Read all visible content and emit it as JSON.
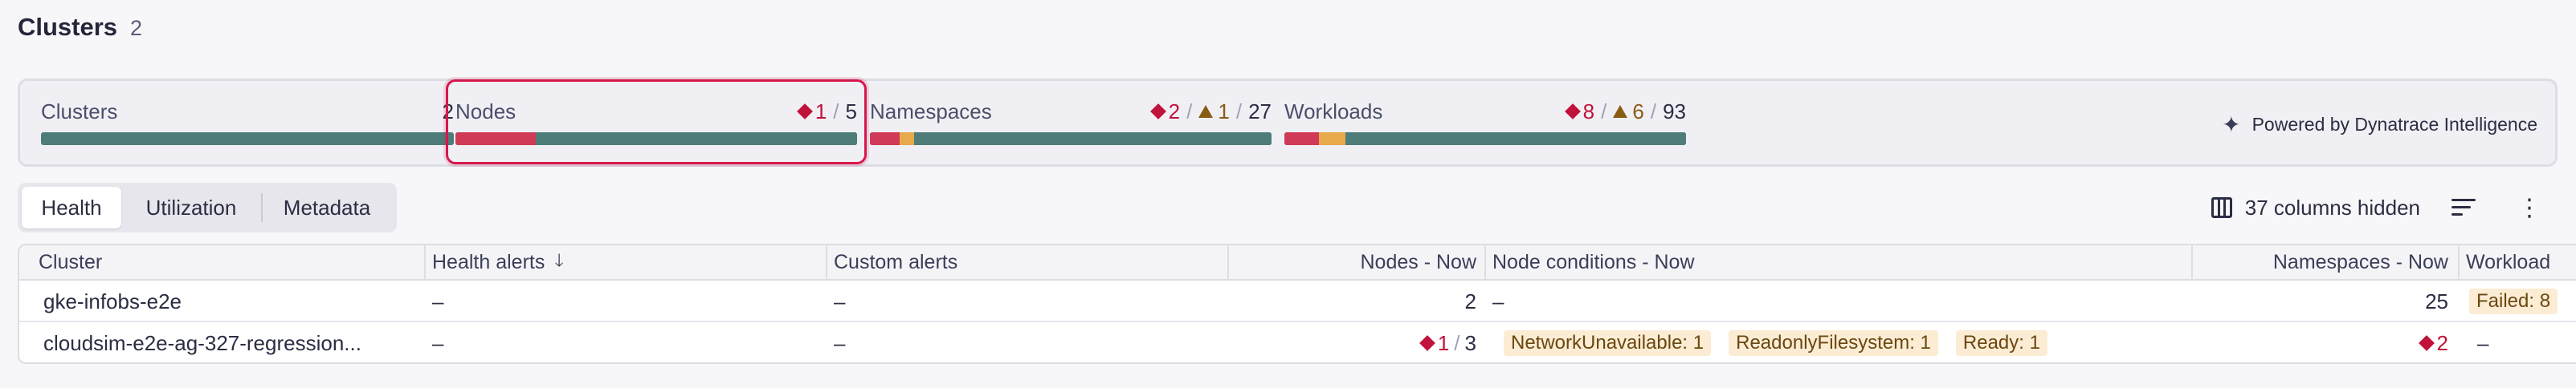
{
  "heading": {
    "title": "Clusters",
    "count": "2"
  },
  "summary": {
    "cards": [
      {
        "label": "Clusters",
        "total": "2",
        "critical": null,
        "warning": null,
        "crit_frac": 0,
        "warn_frac": 0
      },
      {
        "label": "Nodes",
        "total": "5",
        "critical": "1",
        "warning": null,
        "crit_frac": 0.2,
        "warn_frac": 0
      },
      {
        "label": "Namespaces",
        "total": "27",
        "critical": "2",
        "warning": "1",
        "crit_frac": 0.074,
        "warn_frac": 0.037
      },
      {
        "label": "Workloads",
        "total": "93",
        "critical": "8",
        "warning": "6",
        "crit_frac": 0.086,
        "warn_frac": 0.065
      }
    ],
    "selected_card": "Nodes",
    "powered_by": "Powered by Dynatrace Intelligence"
  },
  "tabs": [
    {
      "label": "Health",
      "active": true
    },
    {
      "label": "Utilization",
      "active": false
    },
    {
      "label": "Metadata",
      "active": false
    }
  ],
  "toolbar": {
    "columns_hidden": "37 columns hidden"
  },
  "table": {
    "columns": [
      "Cluster",
      "Health alerts",
      "Custom alerts",
      "Nodes - Now",
      "Node conditions - Now",
      "Namespaces - Now",
      "Workload"
    ],
    "sort_icon": "arrow-down-icon",
    "rows": [
      {
        "cluster": "gke-infobs-e2e",
        "health_alerts": "–",
        "custom_alerts": "–",
        "nodes_critical": null,
        "nodes": "2",
        "node_conditions": [],
        "node_conditions_empty": "–",
        "namespaces_critical": null,
        "namespaces": "25",
        "workload": "Failed: 8"
      },
      {
        "cluster": "cloudsim-e2e-ag-327-regression...",
        "health_alerts": "–",
        "custom_alerts": "–",
        "nodes_critical": "1",
        "nodes": "3",
        "node_conditions": [
          "NetworkUnavailable: 1",
          "ReadonlyFilesystem: 1",
          "Ready: 1"
        ],
        "node_conditions_empty": "",
        "namespaces_critical": "2",
        "namespaces": "",
        "workload": "–"
      }
    ]
  },
  "colors": {
    "critical": "#c1123a",
    "warning": "#8a5b13",
    "healthy_bar": "#4e7c79",
    "selected_border": "#d6184d"
  }
}
